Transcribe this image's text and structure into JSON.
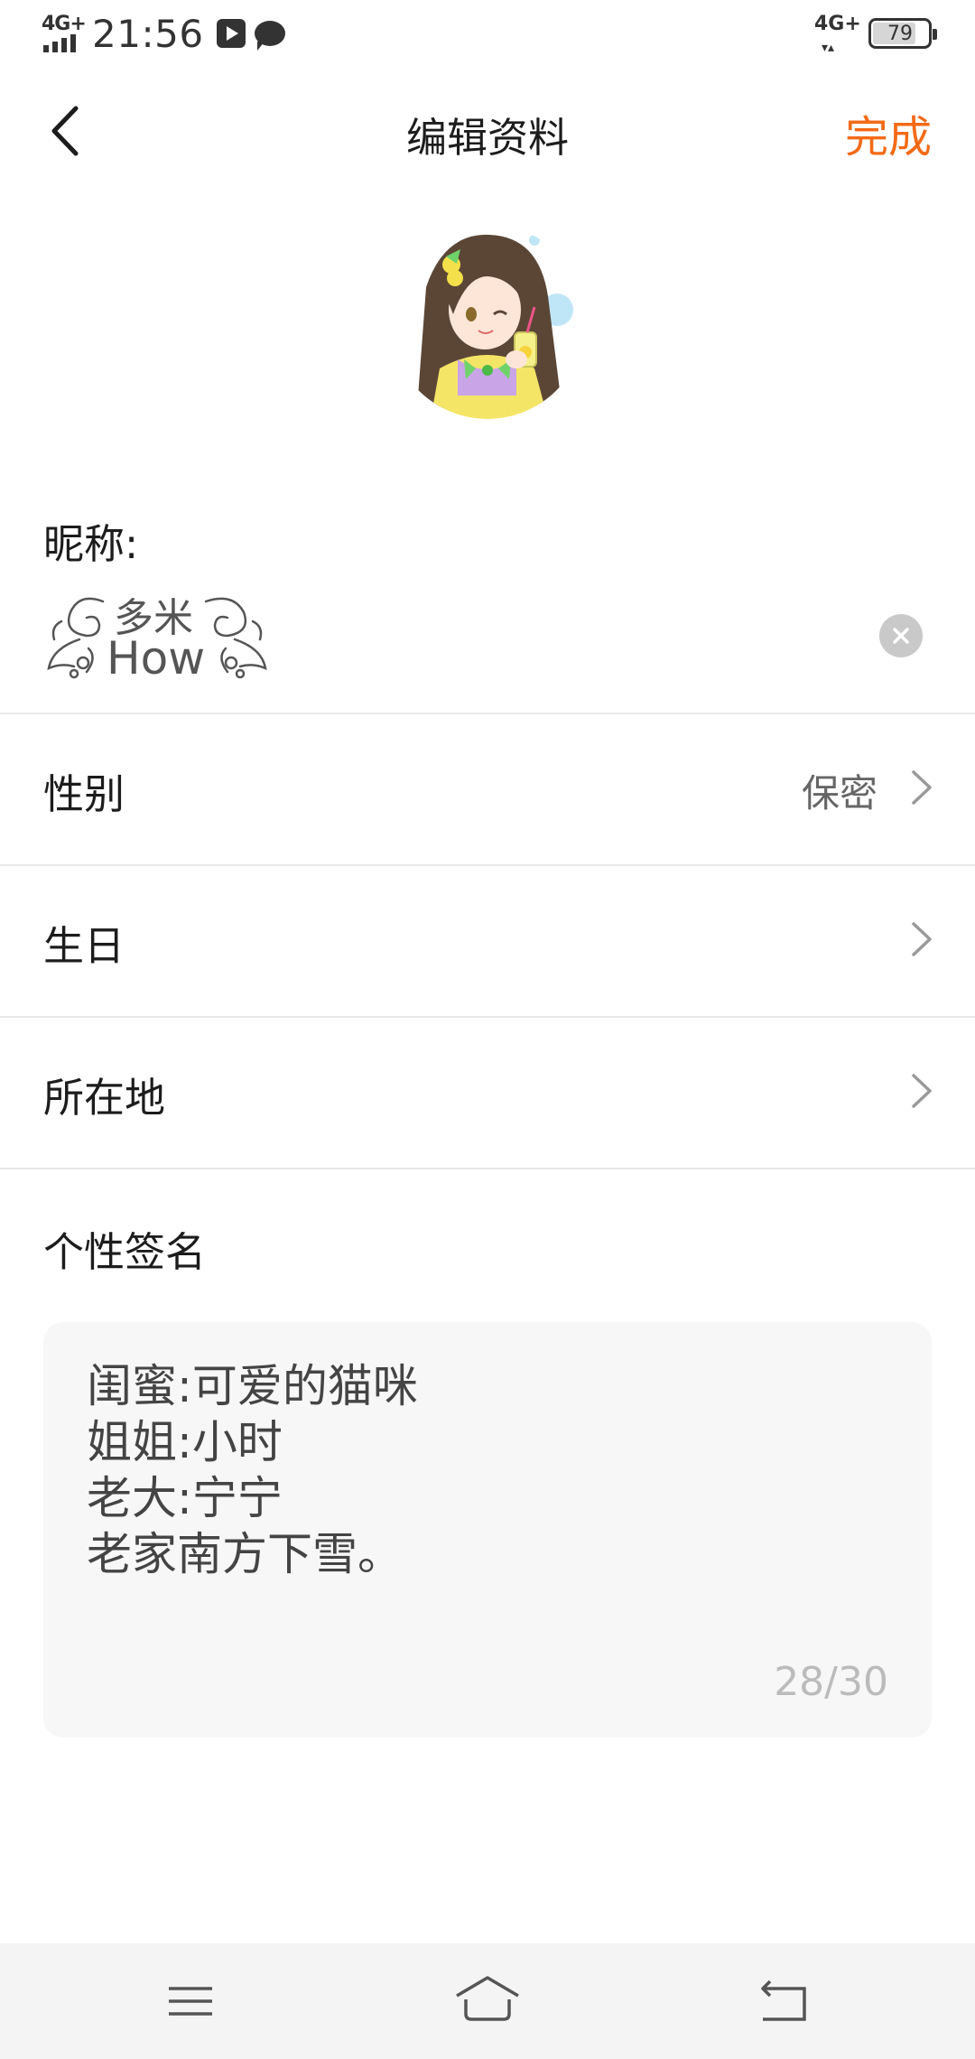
{
  "status_bar": {
    "network_left": "4G+",
    "time": "21:56",
    "network_right": "4G+",
    "battery": "79"
  },
  "header": {
    "title": "编辑资料",
    "done_label": "完成"
  },
  "nickname": {
    "label": "昵称:",
    "line1": "多米",
    "line2": "How"
  },
  "rows": {
    "gender": {
      "label": "性别",
      "value": "保密"
    },
    "birthday": {
      "label": "生日",
      "value": ""
    },
    "location": {
      "label": "所在地",
      "value": ""
    }
  },
  "signature": {
    "label": "个性签名",
    "lines": [
      "闺蜜:可爱的猫咪",
      "姐姐:小时",
      "老大:宁宁",
      "老家南方下雪。"
    ],
    "counter": "28/30"
  },
  "colors": {
    "accent": "#f36a16",
    "text": "#1c1c1c",
    "secondary": "#666666",
    "divider": "#e8e8e8",
    "input_bg": "#f7f7f7"
  },
  "icons": {
    "back": "chevron-left-icon",
    "clear": "clear-icon",
    "chevron": "chevron-right-icon",
    "bottom_menu": "menu-icon",
    "bottom_home": "home-icon",
    "bottom_back": "return-icon"
  }
}
